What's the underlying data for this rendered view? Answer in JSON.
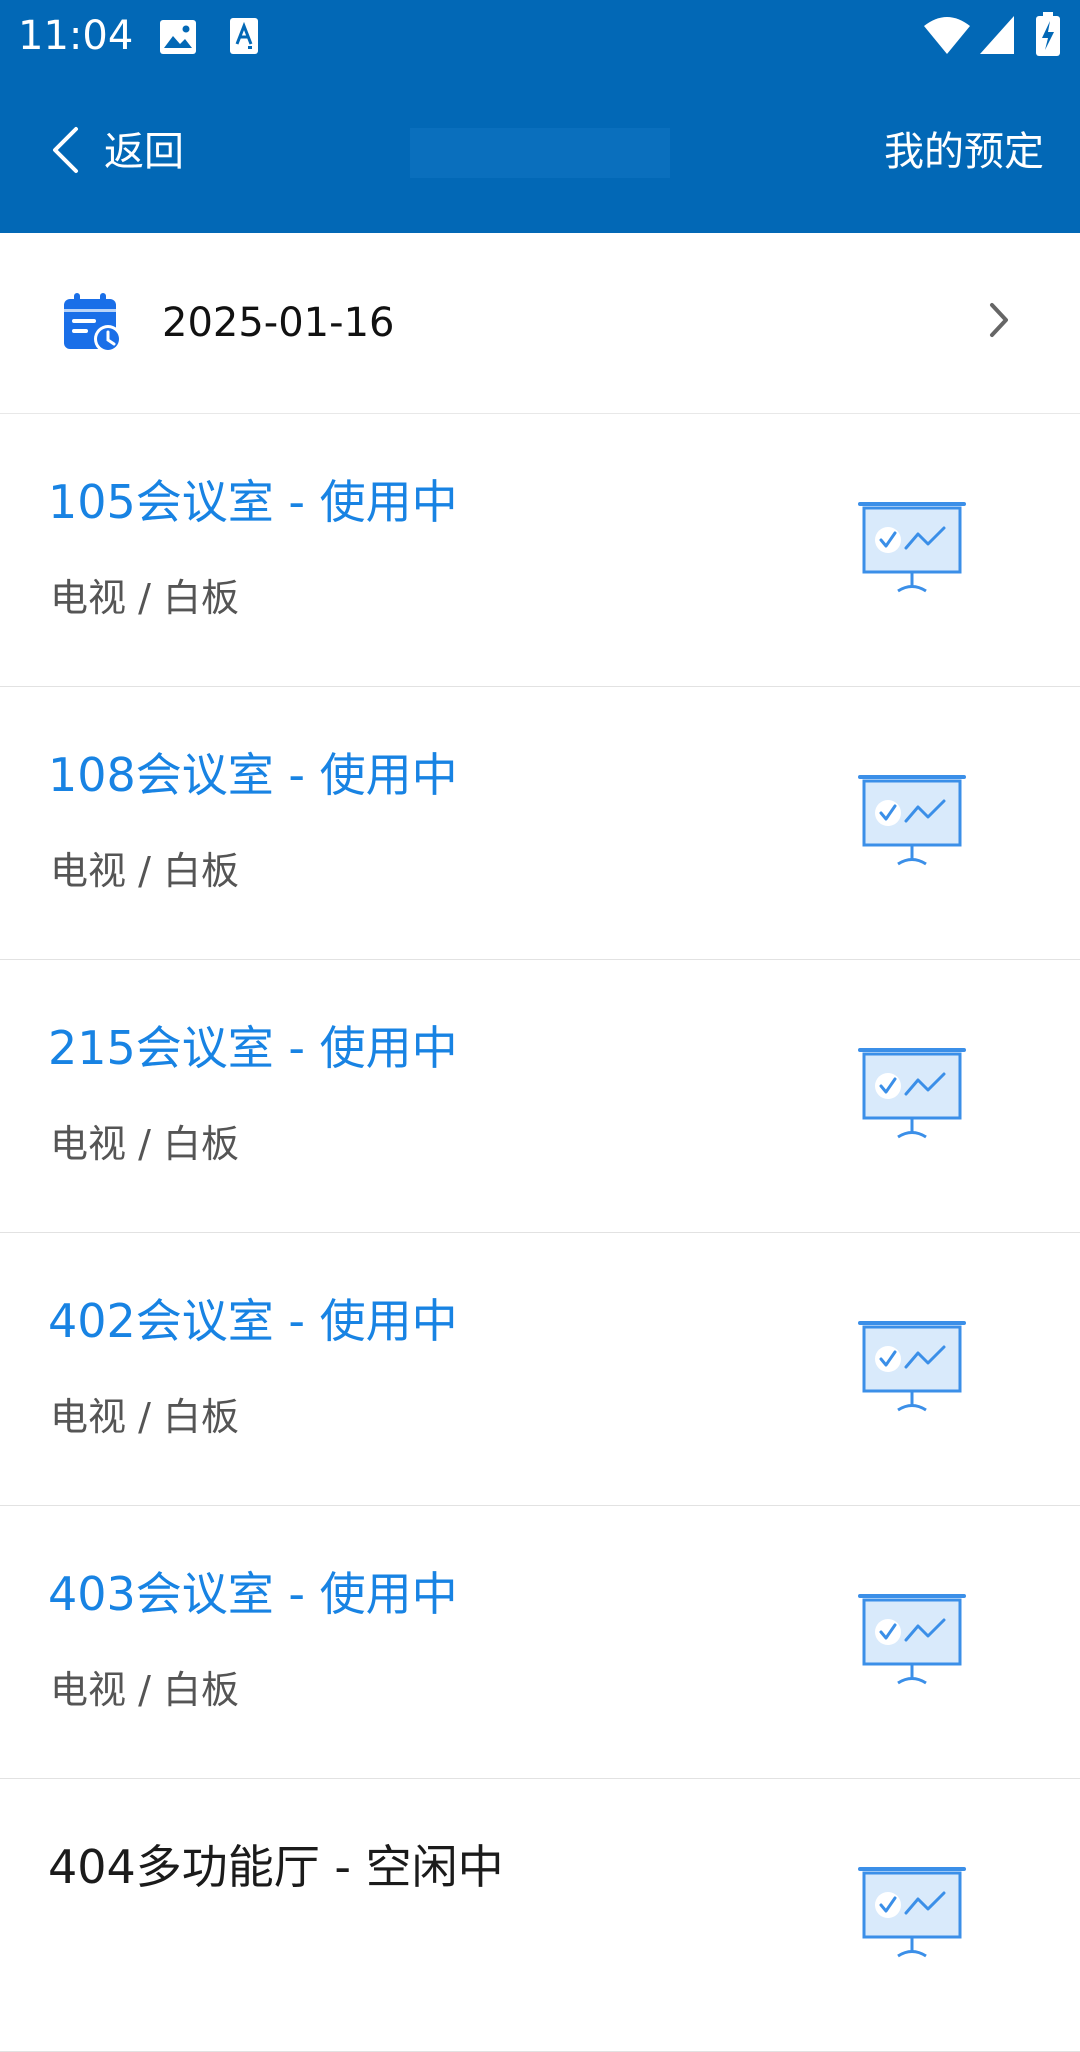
{
  "status_bar": {
    "time": "11:04",
    "icons": [
      "image-icon",
      "text-recognition-icon",
      "wifi-icon",
      "signal-icon",
      "battery-charging-icon"
    ]
  },
  "nav": {
    "back_label": "返回",
    "right_label": "我的预定"
  },
  "date_selector": {
    "date": "2025-01-16",
    "icon": "calendar-clock-icon"
  },
  "rooms": [
    {
      "title": "105会议室 - 使用中",
      "features": "电视 / 白板",
      "busy": true
    },
    {
      "title": "108会议室 - 使用中",
      "features": "电视 / 白板",
      "busy": true
    },
    {
      "title": "215会议室 - 使用中",
      "features": "电视 / 白板",
      "busy": true
    },
    {
      "title": "402会议室 - 使用中",
      "features": "电视 / 白板",
      "busy": true
    },
    {
      "title": "403会议室 - 使用中",
      "features": "电视 / 白板",
      "busy": true
    },
    {
      "title": "404多功能厅 - 空闲中",
      "features": "",
      "busy": false
    }
  ],
  "colors": {
    "header": "#0268b6",
    "busy_text": "#1883e3",
    "free_text": "#1b1b1b",
    "icon_blue": "#3b8fe8"
  }
}
